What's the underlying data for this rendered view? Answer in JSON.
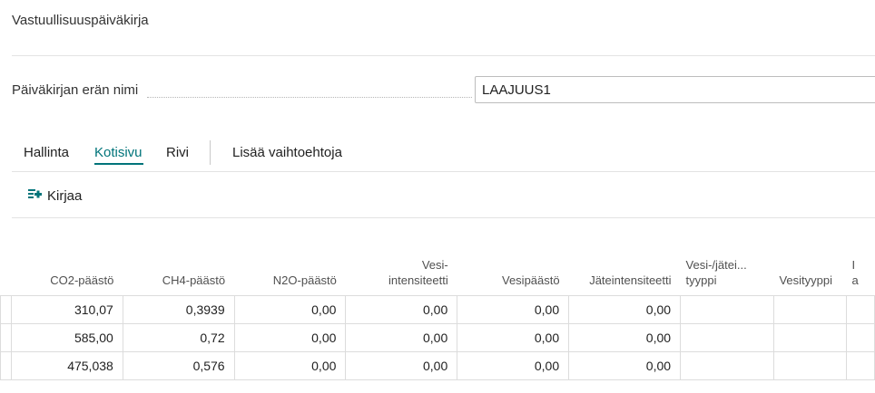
{
  "page": {
    "title": "Vastuullisuuspäiväkirja"
  },
  "batch": {
    "label": "Päiväkirjan erän nimi",
    "value": "LAAJUUS1"
  },
  "tabs": [
    {
      "label": "Hallinta"
    },
    {
      "label": "Kotisivu"
    },
    {
      "label": "Rivi"
    },
    {
      "label": "Lisää vaihtoehtoja"
    }
  ],
  "actions": {
    "post_label": "Kirjaa"
  },
  "colors": {
    "accent": "#00747a",
    "post_icon": "#00747a"
  },
  "table": {
    "headers": [
      "CO2-päästö",
      "CH4-päästö",
      "N2O-päästö",
      "Vesi-\nintensiteetti",
      "Vesipäästö",
      "Jäteintensiteetti",
      "Vesi-/jätei...\ntyyppi",
      "Vesityyppi",
      "I\na"
    ],
    "rows": [
      [
        "310,07",
        "0,3939",
        "0,00",
        "0,00",
        "0,00",
        "0,00",
        "",
        "",
        ""
      ],
      [
        "585,00",
        "0,72",
        "0,00",
        "0,00",
        "0,00",
        "0,00",
        "",
        "",
        ""
      ],
      [
        "475,038",
        "0,576",
        "0,00",
        "0,00",
        "0,00",
        "0,00",
        "",
        "",
        ""
      ]
    ]
  }
}
